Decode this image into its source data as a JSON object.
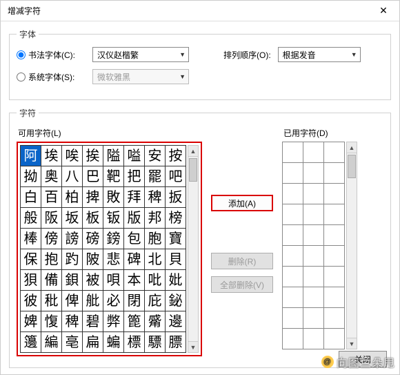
{
  "window": {
    "title": "增减字符"
  },
  "font_group": {
    "legend": "字体",
    "calligraphy_radio": "书法字体(C):",
    "system_radio": "系统字体(S):",
    "calligraphy_value": "汉仪赵楷繁",
    "system_value": "微软雅黑",
    "order_label": "排列顺序(O):",
    "order_value": "根据发音"
  },
  "chars_group": {
    "legend": "字符",
    "available_label": "可用字符(L)",
    "used_label": "已用字符(D)"
  },
  "buttons": {
    "add": "添加(A)",
    "remove": "删除(R)",
    "remove_all": "全部删除(V)",
    "close": "关闭"
  },
  "watermark": "向图兰朵甩",
  "chart_data": {
    "type": "table",
    "title": "可用字符",
    "columns": 8,
    "rows": 10,
    "selected_index": 0,
    "cells": [
      "阿",
      "埃",
      "唉",
      "挨",
      "隘",
      "嗌",
      "安",
      "按",
      "拗",
      "奥",
      "八",
      "巴",
      "靶",
      "把",
      "罷",
      "吧",
      "白",
      "百",
      "柏",
      "捭",
      "敗",
      "拜",
      "稗",
      "扳",
      "般",
      "阪",
      "坂",
      "板",
      "钣",
      "版",
      "邦",
      "榜",
      "棒",
      "傍",
      "謗",
      "磅",
      "鎊",
      "包",
      "胞",
      "寶",
      "保",
      "抱",
      "趵",
      "陂",
      "悲",
      "碑",
      "北",
      "貝",
      "狽",
      "備",
      "鋇",
      "被",
      "唄",
      "本",
      "吡",
      "妣",
      "彼",
      "秕",
      "俾",
      "舭",
      "必",
      "閉",
      "庇",
      "鉍",
      "婢",
      "愎",
      "稗",
      "碧",
      "弊",
      "篦",
      "觱",
      "邊",
      "籩",
      "編",
      "亳",
      "扁",
      "蝙",
      "標",
      "驃",
      "膘"
    ]
  },
  "used_rows": 10
}
